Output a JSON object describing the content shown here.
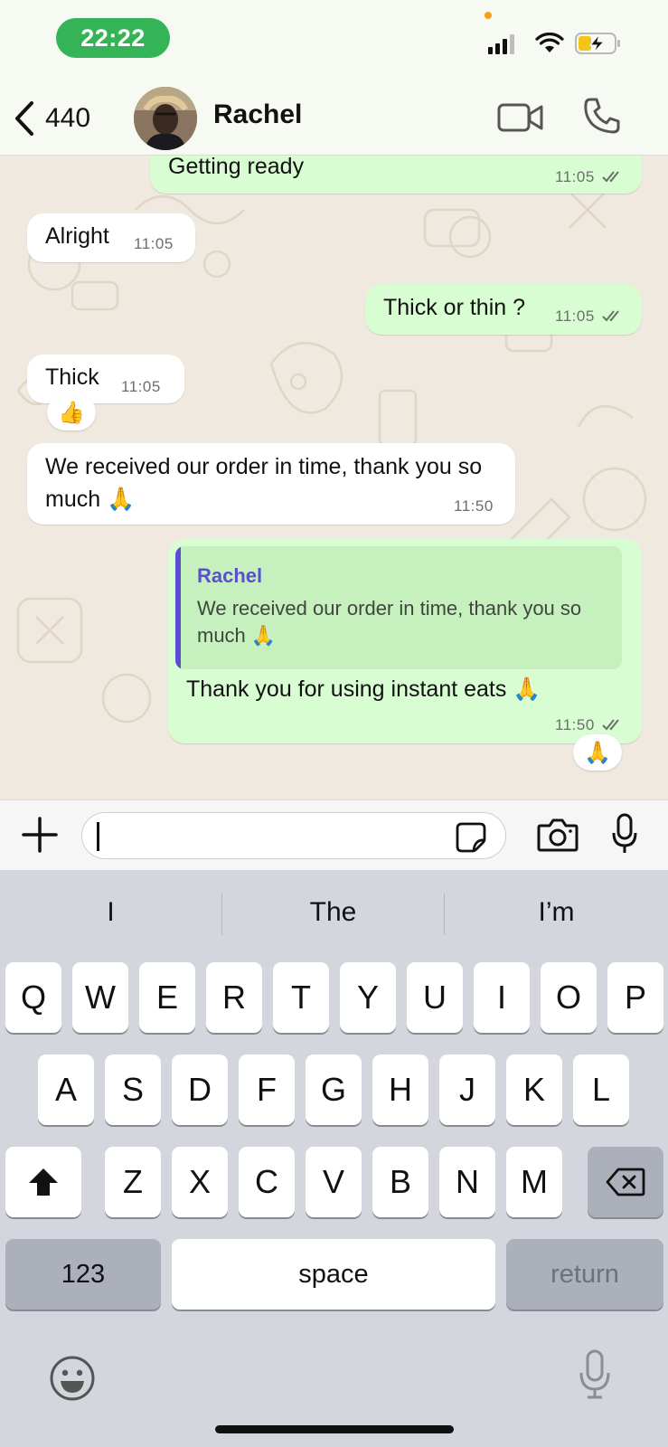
{
  "status_bar": {
    "time": "22:22",
    "icons": [
      "signal-icon",
      "wifi-icon",
      "battery-charging-icon"
    ],
    "time_pill_color": "#34b457"
  },
  "header": {
    "back_count": "440",
    "contact_name": "Rachel",
    "icons": [
      "back-chevron-icon",
      "video-call-icon",
      "phone-icon"
    ]
  },
  "messages": [
    {
      "direction": "out",
      "text": "Getting ready",
      "time": "11:05",
      "status": "read"
    },
    {
      "direction": "in",
      "text": "Alright",
      "time": "11:05"
    },
    {
      "direction": "out",
      "text": "Thick or thin ?",
      "time": "11:05",
      "status": "read"
    },
    {
      "direction": "in",
      "text": "Thick",
      "time": "11:05",
      "reaction": "👍"
    },
    {
      "direction": "in",
      "text": "We received our order in time, thank you so much 🙏",
      "time": "11:50"
    },
    {
      "direction": "out",
      "quote": {
        "author": "Rachel",
        "text": "We received our order in time, thank you so much 🙏"
      },
      "text": "Thank you for using instant eats 🙏",
      "time": "11:50",
      "status": "read",
      "reaction": "🙏"
    }
  ],
  "composer": {
    "input_value": "",
    "icons": [
      "plus-icon",
      "sticker-icon",
      "camera-icon",
      "microphone-icon"
    ]
  },
  "keyboard": {
    "suggestions": [
      "I",
      "The",
      "I’m"
    ],
    "row1": [
      "Q",
      "W",
      "E",
      "R",
      "T",
      "Y",
      "U",
      "I",
      "O",
      "P"
    ],
    "row2": [
      "A",
      "S",
      "D",
      "F",
      "G",
      "H",
      "J",
      "K",
      "L"
    ],
    "row3": [
      "Z",
      "X",
      "C",
      "V",
      "B",
      "N",
      "M"
    ],
    "numbers_key": "123",
    "space_key": "space",
    "return_key": "return",
    "icons": [
      "shift-icon",
      "backspace-icon",
      "emoji-icon",
      "dictation-icon"
    ]
  },
  "colors": {
    "outgoing_bubble": "#d9fdd3",
    "incoming_bubble": "#ffffff",
    "quote_accent": "#5a4fd0",
    "read_ticks": "#6b6f6a",
    "chat_background": "#efe9df"
  }
}
